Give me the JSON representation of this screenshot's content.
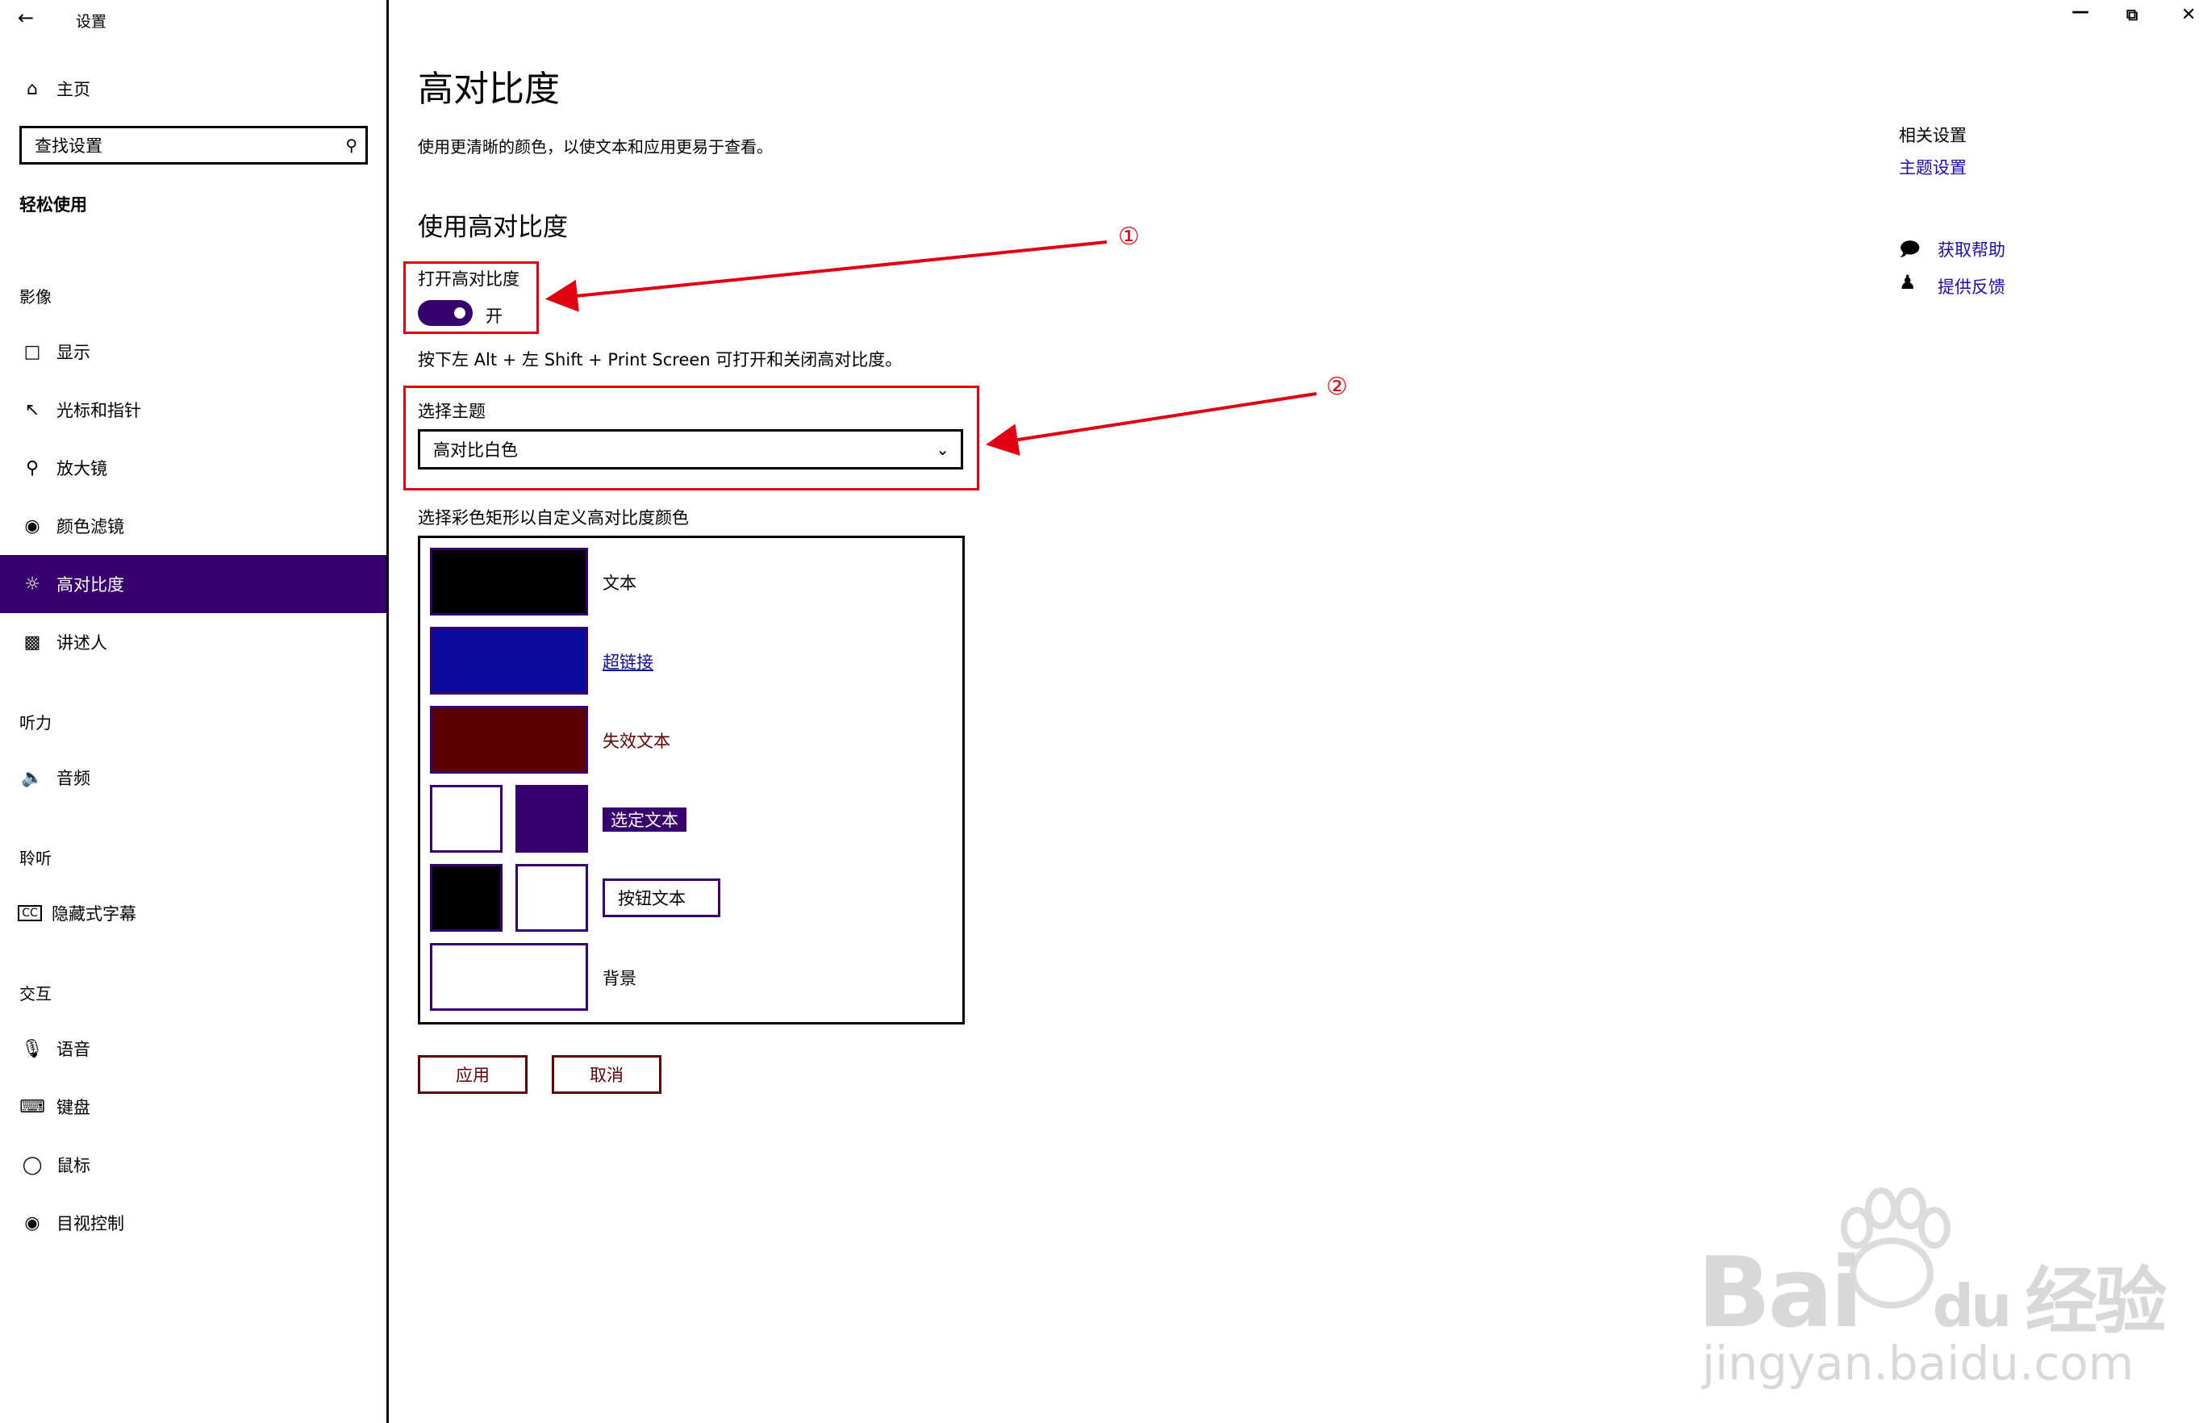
{
  "window": {
    "app_title": "设置",
    "back_icon": "back-arrow-icon",
    "controls": [
      "minimize",
      "maximize",
      "close"
    ]
  },
  "sidebar": {
    "home_label": "主页",
    "search_placeholder": "查找设置",
    "category": "轻松使用",
    "groups": {
      "vision": "影像",
      "hearing": "听力",
      "listening": "聆听",
      "interaction": "交互"
    },
    "items": [
      {
        "label": "显示",
        "icon": "monitor-icon"
      },
      {
        "label": "光标和指针",
        "icon": "cursor-icon"
      },
      {
        "label": "放大镜",
        "icon": "magnifier-icon"
      },
      {
        "label": "颜色滤镜",
        "icon": "palette-icon"
      },
      {
        "label": "高对比度",
        "icon": "contrast-icon",
        "selected": true
      },
      {
        "label": "讲述人",
        "icon": "narrator-icon"
      },
      {
        "label": "音频",
        "icon": "speaker-icon"
      },
      {
        "label": "隐藏式字幕",
        "icon": "cc-icon"
      },
      {
        "label": "语音",
        "icon": "microphone-icon"
      },
      {
        "label": "键盘",
        "icon": "keyboard-icon"
      },
      {
        "label": "鼠标",
        "icon": "mouse-icon"
      },
      {
        "label": "目视控制",
        "icon": "eye-control-icon"
      }
    ]
  },
  "main": {
    "title": "高对比度",
    "description": "使用更清晰的颜色，以使文本和应用更易于查看。",
    "section_title": "使用高对比度",
    "toggle_label": "打开高对比度",
    "toggle_state": "开",
    "toggle_on": true,
    "shortcut_hint": "按下左 Alt + 左 Shift + Print Screen 可打开和关闭高对比度。",
    "theme_label": "选择主题",
    "theme_value": "高对比白色",
    "custom_label": "选择彩色矩形以自定义高对比度颜色",
    "color_items": {
      "text": "文本",
      "hyperlink": "超链接",
      "disabled": "失效文本",
      "selected": "选定文本",
      "button": "按钮文本",
      "background": "背景"
    },
    "colors": {
      "text": "#000000",
      "hyperlink": "#0a0a9c",
      "disabled": "#5a0000",
      "selected_fg": "#ffffff",
      "selected_bg": "#37006e",
      "button_fg": "#000000",
      "button_bg": "#ffffff",
      "background": "#ffffff",
      "accent": "#37006e"
    },
    "apply_button": "应用",
    "cancel_button": "取消"
  },
  "related": {
    "heading": "相关设置",
    "theme_settings": "主题设置",
    "get_help": "获取帮助",
    "feedback": "提供反馈"
  },
  "annotations": {
    "marker_1": "①",
    "marker_2": "②",
    "color": "#e1000f"
  },
  "watermark": {
    "brand": "Bai",
    "brand_du": "du",
    "brand_cn": "经验",
    "url": "jingyan.baidu.com"
  }
}
